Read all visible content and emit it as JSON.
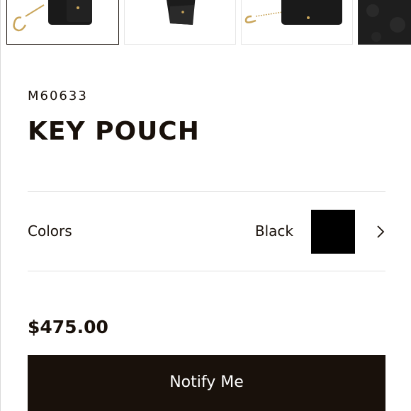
{
  "thumbnails": [
    {
      "name": "key-pouch-front"
    },
    {
      "name": "key-pouch-side"
    },
    {
      "name": "key-pouch-back"
    },
    {
      "name": "key-pouch-detail"
    }
  ],
  "product": {
    "sku": "M60633",
    "title": "KEY POUCH",
    "colors_label": "Colors",
    "color_value": "Black",
    "swatch_color": "#000000",
    "price": "$475.00",
    "notify_label": "Notify Me"
  },
  "theme": {
    "primary": "#19110b",
    "divider": "#e1e1e1",
    "gold": "#c9a55a"
  }
}
